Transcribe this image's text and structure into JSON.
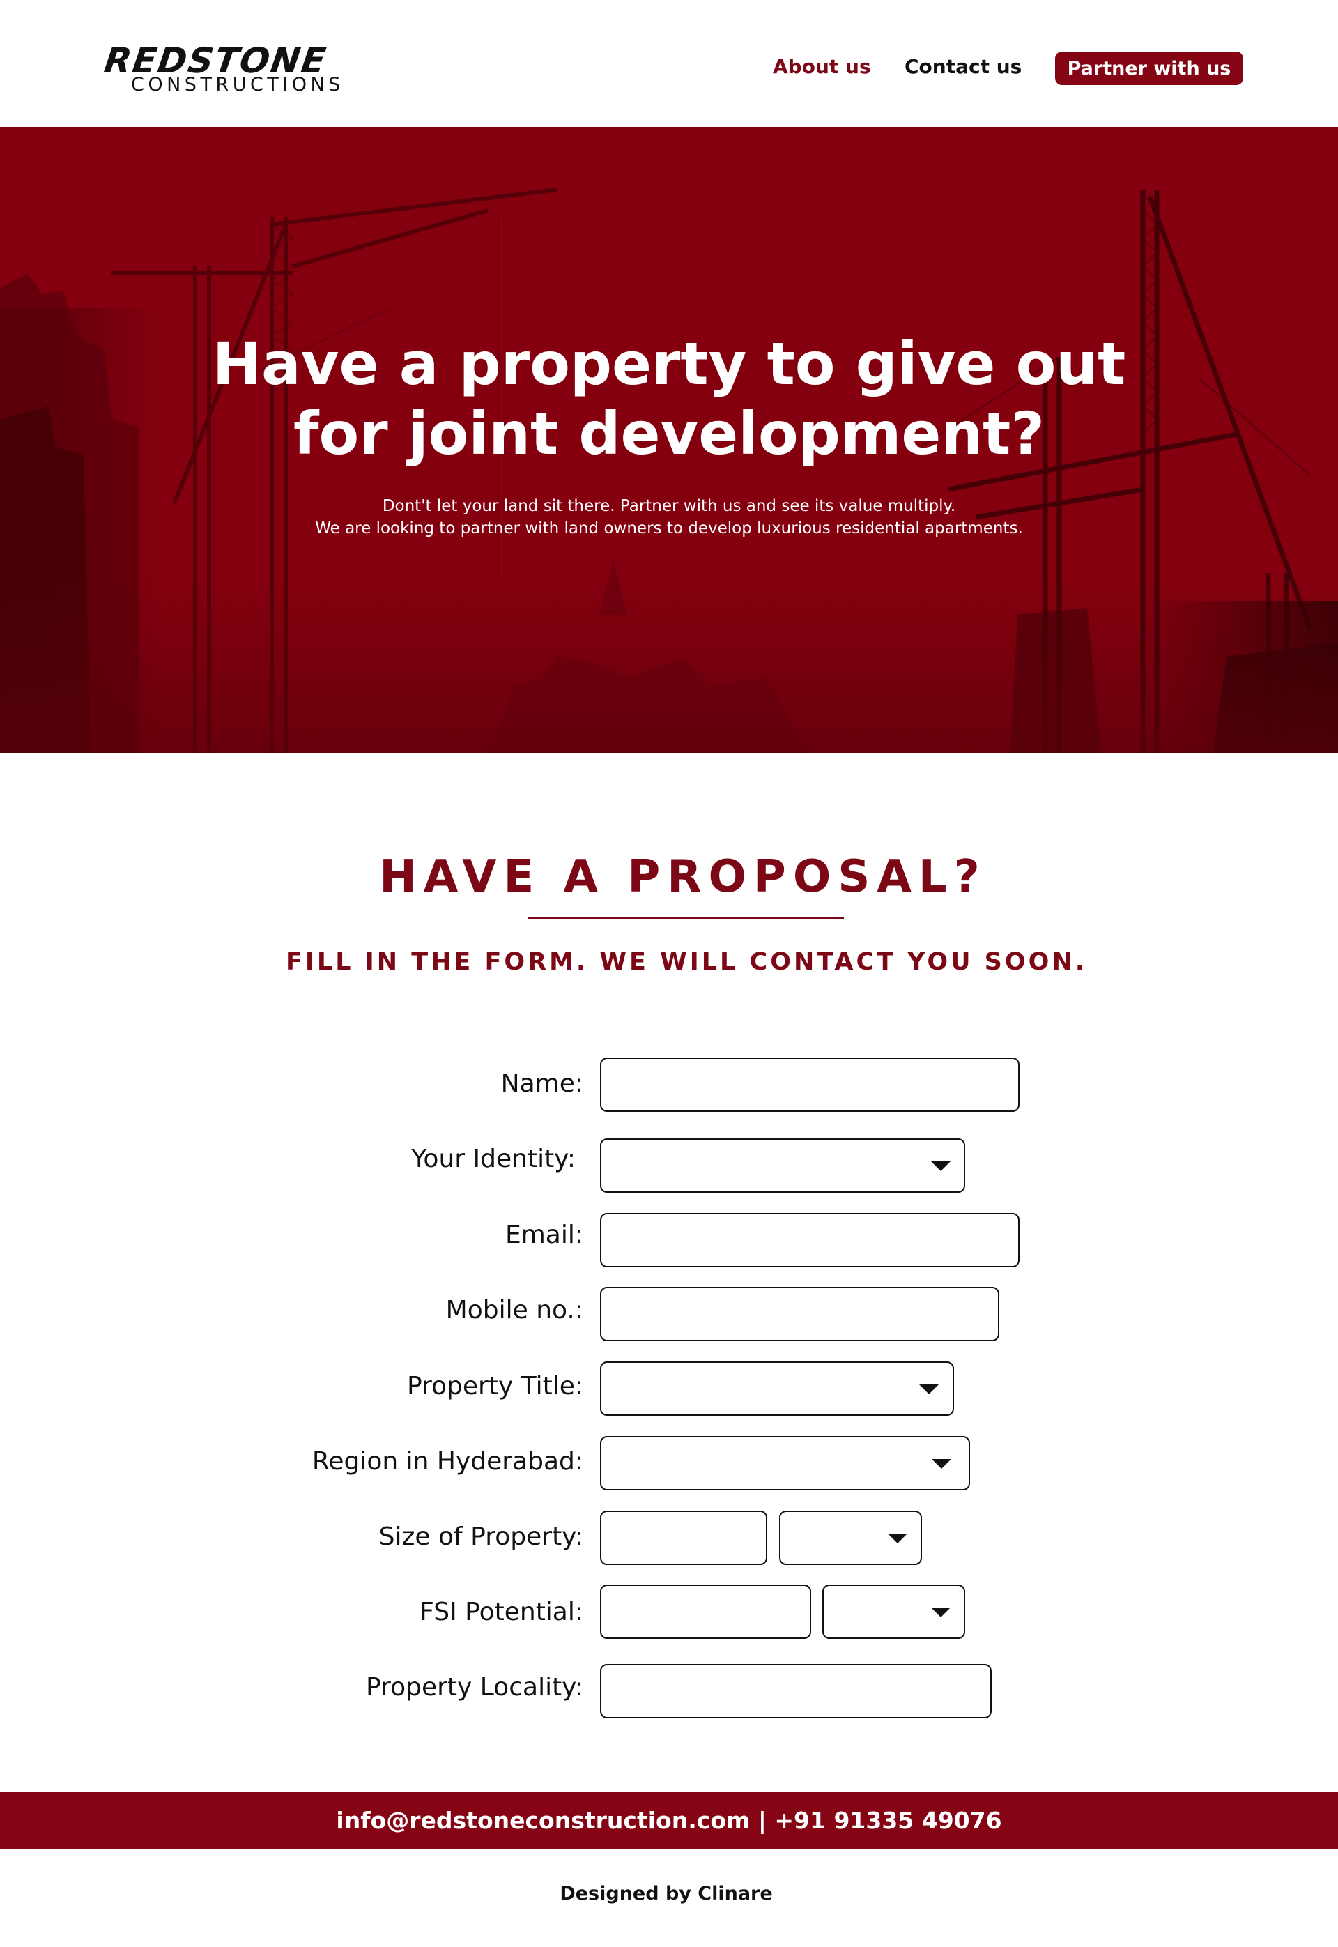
{
  "header": {
    "logo_main": "REDSTONE",
    "logo_sub": "CONSTRUCTIONS",
    "nav": {
      "about": "About us",
      "contact": "Contact us",
      "partner": "Partner with us"
    }
  },
  "hero": {
    "title_line1": "Have a property to give out",
    "title_line2": "for joint development?",
    "sub_line1": "Dont't let your land sit there. Partner with us and see its value multiply.",
    "sub_line2": "We are looking to partner with land owners to develop luxurious residential apartments."
  },
  "proposal": {
    "title": "HAVE A PROPOSAL?",
    "subtitle": "FILL IN THE FORM. WE WILL CONTACT YOU SOON."
  },
  "form": {
    "name_label": "Name:",
    "name_value": "",
    "identity_label": "Your Identity:",
    "identity_value": "",
    "email_label": "Email:",
    "email_value": "",
    "mobile_label": "Mobile no.:",
    "mobile_value": "",
    "title_label": "Property Title:",
    "title_value": "",
    "region_label": "Region in Hyderabad:",
    "region_value": "",
    "size_label": "Size of Property:",
    "size_value": "",
    "size_unit": "",
    "fsi_label": "FSI Potential:",
    "fsi_value": "",
    "fsi_unit": "",
    "locality_label": "Property Locality:",
    "locality_value": ""
  },
  "footer": {
    "contact": "info@redstoneconstruction.com | +91 91335 49076",
    "credit": "Designed by Clinare"
  },
  "colors": {
    "brand": "#850515",
    "hero_bg": "#85000e",
    "text": "#111111"
  }
}
